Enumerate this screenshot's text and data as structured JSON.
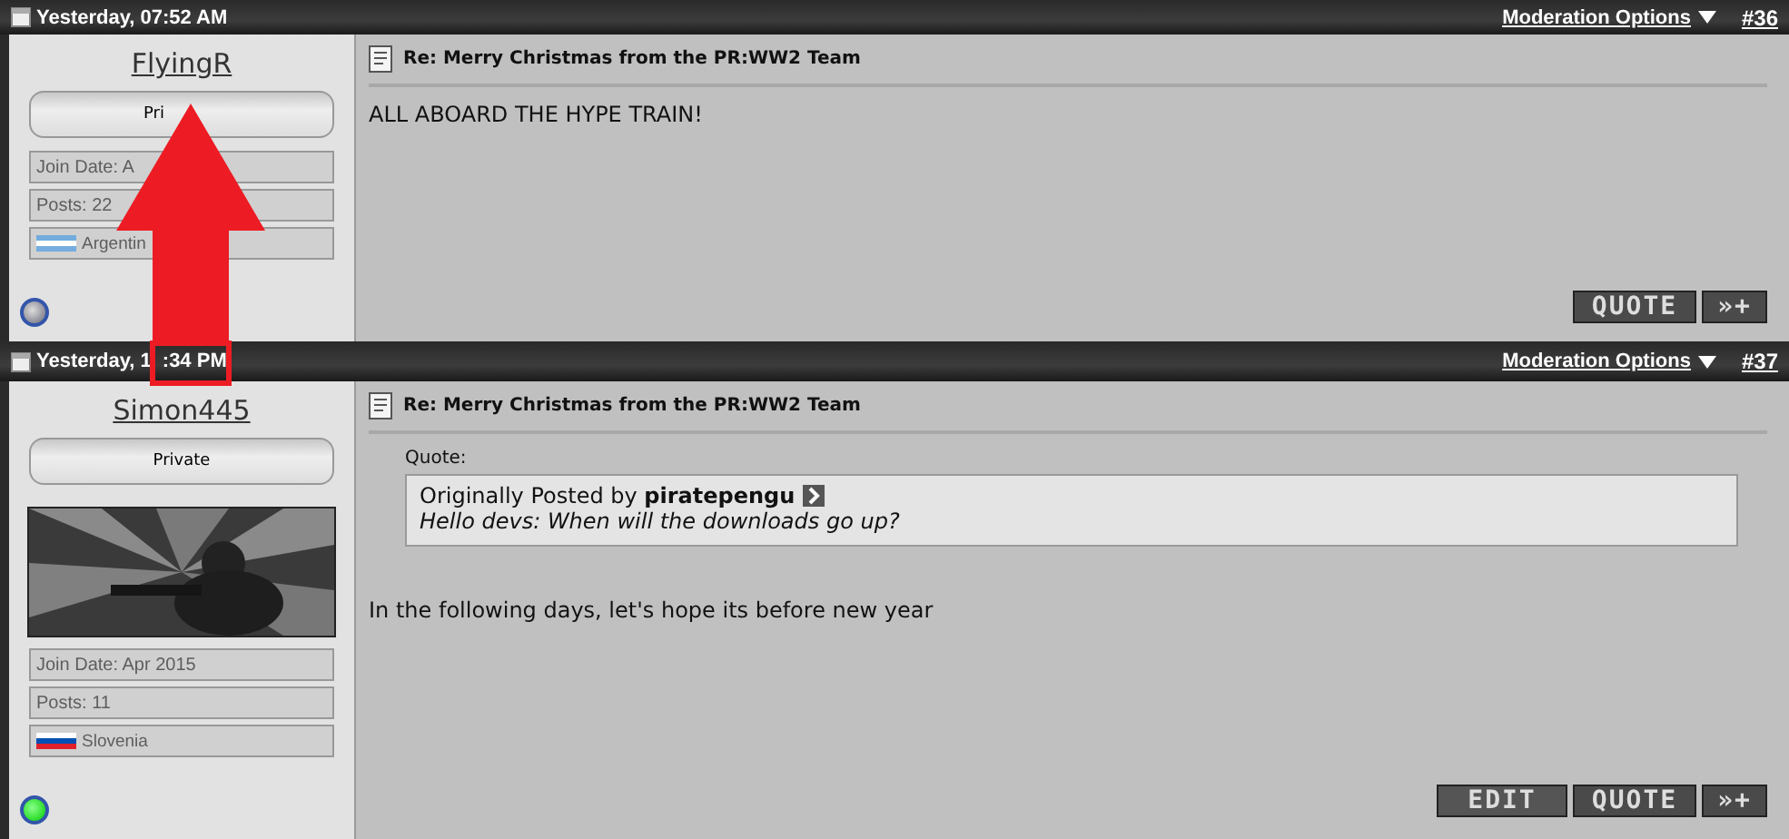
{
  "annotation": {
    "kind": "arrow"
  },
  "posts": [
    {
      "date": "Yesterday, 07:52 AM",
      "moderation": "Moderation Options",
      "number": "#36",
      "username": "FlyingR",
      "rank": "Pri",
      "join_date": "Join Date: A",
      "post_count": "Posts: 22",
      "country": "Argentin",
      "flag": [
        {
          "color": "#74acdf"
        },
        {
          "color": "#ffffff"
        },
        {
          "color": "#74acdf"
        }
      ],
      "online": false,
      "title": "Re: Merry Christmas from the PR:WW2 Team",
      "body": "ALL ABOARD THE HYPE TRAIN!",
      "buttons": [
        {
          "label": "QUOTE",
          "kind": "quote"
        },
        {
          "label": "»+",
          "kind": "multiquote"
        }
      ]
    },
    {
      "date": "Yesterday, 1",
      "date_end": ":34 PM",
      "moderation": "Moderation Options",
      "number": "#37",
      "username": "Simon445",
      "rank": "Private",
      "join_date": "Join Date: Apr 2015",
      "post_count": "Posts: 11",
      "country": "Slovenia",
      "flag": [
        {
          "color": "#ffffff"
        },
        {
          "color": "#0050b4"
        },
        {
          "color": "#e0202a"
        }
      ],
      "online": true,
      "title": "Re: Merry Christmas from the PR:WW2 Team",
      "quote": {
        "label": "Quote:",
        "prefix": "Originally Posted by",
        "author": "piratepengu",
        "text": "Hello devs: When will the downloads go up?"
      },
      "body": "In the following days, let's hope its before new year",
      "buttons": [
        {
          "label": "EDIT",
          "kind": "edit"
        },
        {
          "label": "QUOTE",
          "kind": "quote"
        },
        {
          "label": "»+",
          "kind": "multiquote"
        }
      ]
    }
  ]
}
